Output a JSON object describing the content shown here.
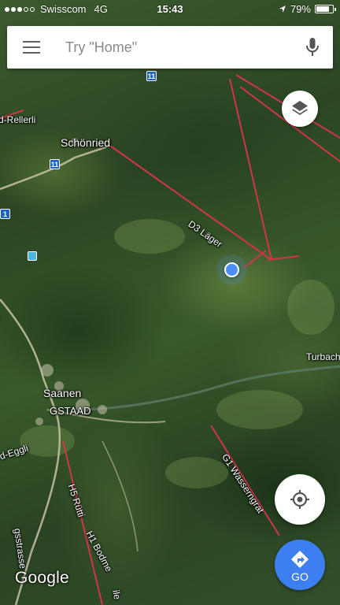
{
  "status_bar": {
    "carrier": "Swisscom",
    "network": "4G",
    "time": "15:43",
    "battery": "79%",
    "battery_level": 0.79,
    "signal_bars_filled": 3,
    "signal_bars_total": 5
  },
  "search": {
    "placeholder": "Try \"Home\""
  },
  "map": {
    "labels": {
      "rellerli": "d-Rellerli",
      "schonried": "Schönried",
      "d3_lager": "D3 Läger",
      "turbach": "Turbach",
      "strasse": "rasse",
      "saanen": "Saanen",
      "gstaad": "GSTAAD",
      "eggli": "d-Eggli",
      "g1_wasserngrat": "G1 Wasserngrat",
      "h5_rutti": "H5 Rütti",
      "h1_bodme": "H1 Bodme",
      "gsstrasse": "gsstrasse",
      "ile": "ile"
    },
    "route_shields": [
      "11",
      "11",
      "1"
    ]
  },
  "buttons": {
    "go_label": "GO"
  },
  "attribution": {
    "logo_text": "Google"
  },
  "colors": {
    "accent_blue": "#3d7ef0",
    "location_blue": "#4c8ef5",
    "lift_line": "#d0354a",
    "route_shield": "#1f63c6"
  }
}
